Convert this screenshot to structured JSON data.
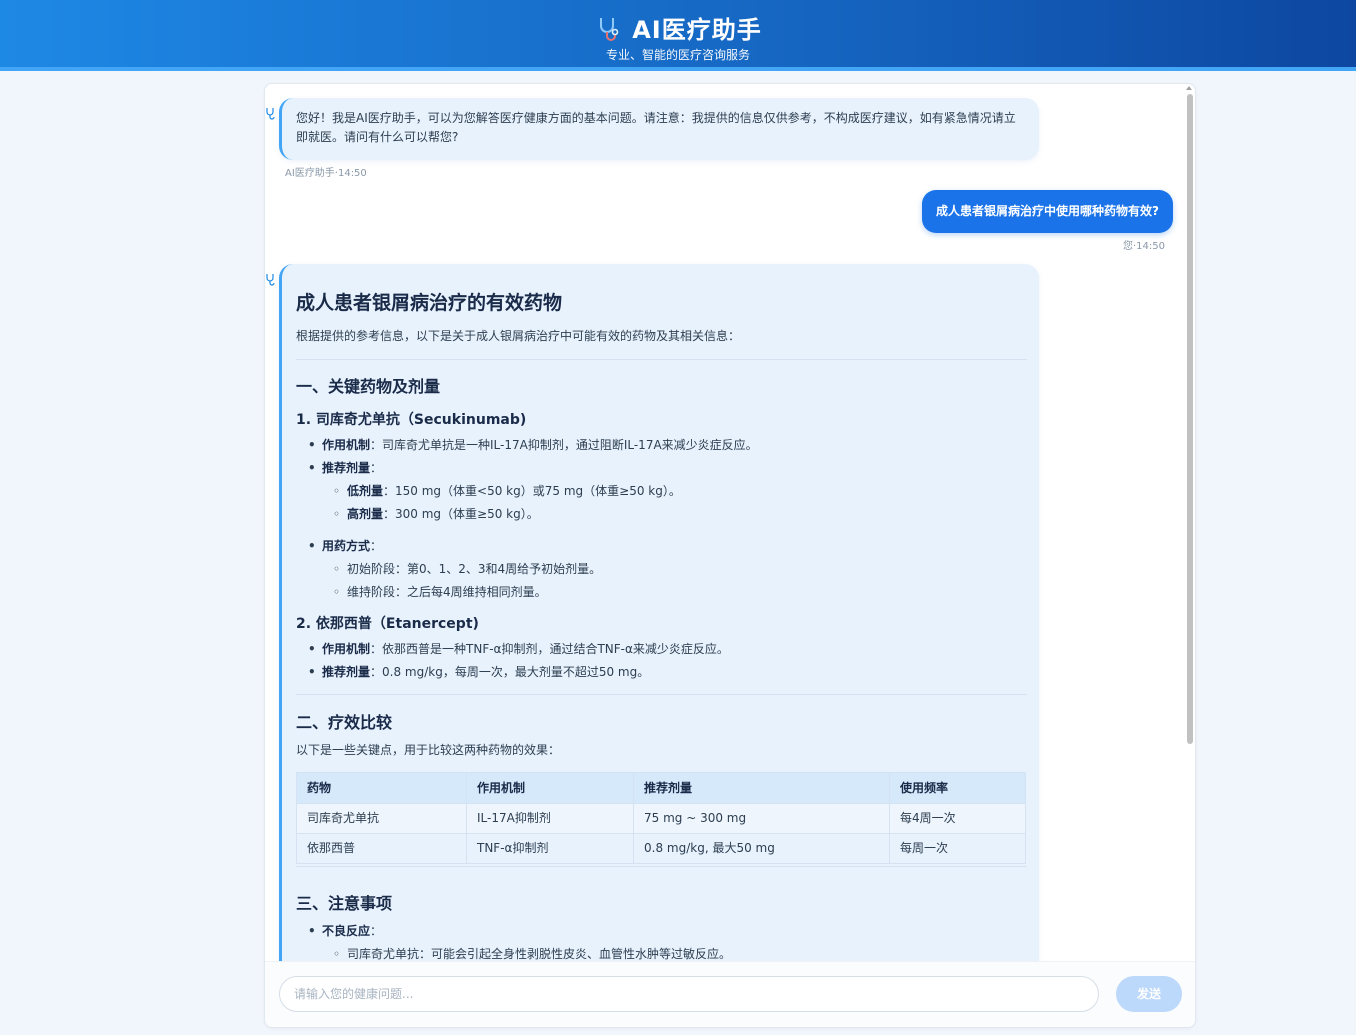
{
  "header": {
    "title": "AI医疗助手",
    "subtitle": "专业、智能的医疗咨询服务",
    "icon": "stethoscope-icon"
  },
  "messages": {
    "greeting": {
      "text": "您好！我是AI医疗助手，可以为您解答医疗健康方面的基本问题。请注意：我提供的信息仅供参考，不构成医疗建议，如有紧急情况请立即就医。请问有什么可以帮您?",
      "meta": "AI医疗助手·14:50"
    },
    "user": {
      "text": "成人患者银屑病治疗中使用哪种药物有效?",
      "meta": "您·14:50"
    },
    "answer": {
      "title": "成人患者银屑病治疗的有效药物",
      "intro": "根据提供的参考信息，以下是关于成人银屑病治疗中可能有效的药物及其相关信息：",
      "section1": "一、关键药物及剂量",
      "drug1": {
        "heading": "1. 司库奇尤单抗（Secukinumab)",
        "mech_label": "作用机制",
        "mech_text": "：司库奇尤单抗是一种IL-17A抑制剂，通过阻断IL-17A来减少炎症反应。",
        "dose_label": "推荐剂量",
        "dose_suffix": "：",
        "low_label": "低剂量",
        "low_text": "：150 mg（体重<50 kg）或75 mg（体重≥50 kg）。",
        "high_label": "高剂量",
        "high_text": "：300 mg（体重≥50 kg）。",
        "usage_label": "用药方式",
        "usage_suffix": "：",
        "usage_1": "初始阶段：第0、1、2、3和4周给予初始剂量。",
        "usage_2": "维持阶段：之后每4周维持相同剂量。"
      },
      "drug2": {
        "heading": "2. 依那西普（Etanercept)",
        "mech_label": "作用机制",
        "mech_text": "：依那西普是一种TNF-α抑制剂，通过结合TNF-α来减少炎症反应。",
        "dose_label": "推荐剂量",
        "dose_text": "：0.8 mg/kg，每周一次，最大剂量不超过50 mg。"
      },
      "section2": "二、疗效比较",
      "compare_intro": "以下是一些关键点，用于比较这两种药物的效果：",
      "table": {
        "headers": [
          "药物",
          "作用机制",
          "推荐剂量",
          "使用频率"
        ],
        "rows": [
          [
            "司库奇尤单抗",
            "IL-17A抑制剂",
            "75 mg ~ 300 mg",
            "每4周一次"
          ],
          [
            "依那西普",
            "TNF-α抑制剂",
            "0.8 mg/kg, 最大50 mg",
            "每周一次"
          ]
        ]
      },
      "section3": "三、注意事项",
      "adverse_label": "不良反应",
      "adverse_suffix": "：",
      "adverse_1": "司库奇尤单抗：可能会引起全身性剥脱性皮炎、血管性水肿等过敏反应。"
    }
  },
  "input": {
    "placeholder": "请输入您的健康问题...",
    "send_label": "发送"
  },
  "colors": {
    "header_start": "#1e88e5",
    "header_end": "#0d47a1",
    "user_bubble": "#1a73e8",
    "bot_bubble": "#e8f2fd",
    "send_disabled": "#bcd8fb"
  }
}
